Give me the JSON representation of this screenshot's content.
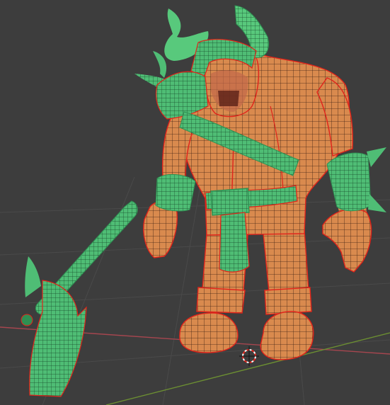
{
  "viewport": {
    "background_color": "#3d3d3d",
    "grid_color": "#4a4a4a",
    "x_axis_color": "#a6464f",
    "y_axis_color": "#6c8f32"
  },
  "model": {
    "skin_color": "#d98a4e",
    "wire_color": "#2a160c",
    "seam_color": "#e0241b",
    "armor_color": "#4fbd75",
    "armor_dark_color": "#2f8f52",
    "horn_color": "#58c97c"
  },
  "icons": {
    "cursor": "3d-cursor-icon"
  }
}
